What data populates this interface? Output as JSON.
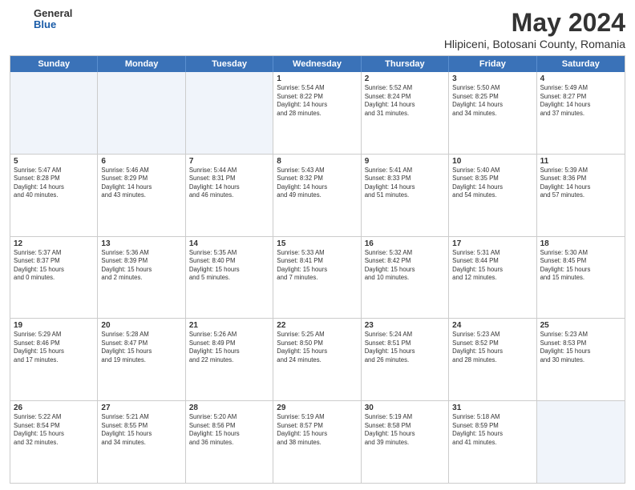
{
  "header": {
    "logo_general": "General",
    "logo_blue": "Blue",
    "month": "May 2024",
    "location": "Hlipiceni, Botosani County, Romania"
  },
  "weekdays": [
    "Sunday",
    "Monday",
    "Tuesday",
    "Wednesday",
    "Thursday",
    "Friday",
    "Saturday"
  ],
  "weeks": [
    [
      {
        "day": "",
        "info": ""
      },
      {
        "day": "",
        "info": ""
      },
      {
        "day": "",
        "info": ""
      },
      {
        "day": "1",
        "info": "Sunrise: 5:54 AM\nSunset: 8:22 PM\nDaylight: 14 hours\nand 28 minutes."
      },
      {
        "day": "2",
        "info": "Sunrise: 5:52 AM\nSunset: 8:24 PM\nDaylight: 14 hours\nand 31 minutes."
      },
      {
        "day": "3",
        "info": "Sunrise: 5:50 AM\nSunset: 8:25 PM\nDaylight: 14 hours\nand 34 minutes."
      },
      {
        "day": "4",
        "info": "Sunrise: 5:49 AM\nSunset: 8:27 PM\nDaylight: 14 hours\nand 37 minutes."
      }
    ],
    [
      {
        "day": "5",
        "info": "Sunrise: 5:47 AM\nSunset: 8:28 PM\nDaylight: 14 hours\nand 40 minutes."
      },
      {
        "day": "6",
        "info": "Sunrise: 5:46 AM\nSunset: 8:29 PM\nDaylight: 14 hours\nand 43 minutes."
      },
      {
        "day": "7",
        "info": "Sunrise: 5:44 AM\nSunset: 8:31 PM\nDaylight: 14 hours\nand 46 minutes."
      },
      {
        "day": "8",
        "info": "Sunrise: 5:43 AM\nSunset: 8:32 PM\nDaylight: 14 hours\nand 49 minutes."
      },
      {
        "day": "9",
        "info": "Sunrise: 5:41 AM\nSunset: 8:33 PM\nDaylight: 14 hours\nand 51 minutes."
      },
      {
        "day": "10",
        "info": "Sunrise: 5:40 AM\nSunset: 8:35 PM\nDaylight: 14 hours\nand 54 minutes."
      },
      {
        "day": "11",
        "info": "Sunrise: 5:39 AM\nSunset: 8:36 PM\nDaylight: 14 hours\nand 57 minutes."
      }
    ],
    [
      {
        "day": "12",
        "info": "Sunrise: 5:37 AM\nSunset: 8:37 PM\nDaylight: 15 hours\nand 0 minutes."
      },
      {
        "day": "13",
        "info": "Sunrise: 5:36 AM\nSunset: 8:39 PM\nDaylight: 15 hours\nand 2 minutes."
      },
      {
        "day": "14",
        "info": "Sunrise: 5:35 AM\nSunset: 8:40 PM\nDaylight: 15 hours\nand 5 minutes."
      },
      {
        "day": "15",
        "info": "Sunrise: 5:33 AM\nSunset: 8:41 PM\nDaylight: 15 hours\nand 7 minutes."
      },
      {
        "day": "16",
        "info": "Sunrise: 5:32 AM\nSunset: 8:42 PM\nDaylight: 15 hours\nand 10 minutes."
      },
      {
        "day": "17",
        "info": "Sunrise: 5:31 AM\nSunset: 8:44 PM\nDaylight: 15 hours\nand 12 minutes."
      },
      {
        "day": "18",
        "info": "Sunrise: 5:30 AM\nSunset: 8:45 PM\nDaylight: 15 hours\nand 15 minutes."
      }
    ],
    [
      {
        "day": "19",
        "info": "Sunrise: 5:29 AM\nSunset: 8:46 PM\nDaylight: 15 hours\nand 17 minutes."
      },
      {
        "day": "20",
        "info": "Sunrise: 5:28 AM\nSunset: 8:47 PM\nDaylight: 15 hours\nand 19 minutes."
      },
      {
        "day": "21",
        "info": "Sunrise: 5:26 AM\nSunset: 8:49 PM\nDaylight: 15 hours\nand 22 minutes."
      },
      {
        "day": "22",
        "info": "Sunrise: 5:25 AM\nSunset: 8:50 PM\nDaylight: 15 hours\nand 24 minutes."
      },
      {
        "day": "23",
        "info": "Sunrise: 5:24 AM\nSunset: 8:51 PM\nDaylight: 15 hours\nand 26 minutes."
      },
      {
        "day": "24",
        "info": "Sunrise: 5:23 AM\nSunset: 8:52 PM\nDaylight: 15 hours\nand 28 minutes."
      },
      {
        "day": "25",
        "info": "Sunrise: 5:23 AM\nSunset: 8:53 PM\nDaylight: 15 hours\nand 30 minutes."
      }
    ],
    [
      {
        "day": "26",
        "info": "Sunrise: 5:22 AM\nSunset: 8:54 PM\nDaylight: 15 hours\nand 32 minutes."
      },
      {
        "day": "27",
        "info": "Sunrise: 5:21 AM\nSunset: 8:55 PM\nDaylight: 15 hours\nand 34 minutes."
      },
      {
        "day": "28",
        "info": "Sunrise: 5:20 AM\nSunset: 8:56 PM\nDaylight: 15 hours\nand 36 minutes."
      },
      {
        "day": "29",
        "info": "Sunrise: 5:19 AM\nSunset: 8:57 PM\nDaylight: 15 hours\nand 38 minutes."
      },
      {
        "day": "30",
        "info": "Sunrise: 5:19 AM\nSunset: 8:58 PM\nDaylight: 15 hours\nand 39 minutes."
      },
      {
        "day": "31",
        "info": "Sunrise: 5:18 AM\nSunset: 8:59 PM\nDaylight: 15 hours\nand 41 minutes."
      },
      {
        "day": "",
        "info": ""
      }
    ]
  ]
}
